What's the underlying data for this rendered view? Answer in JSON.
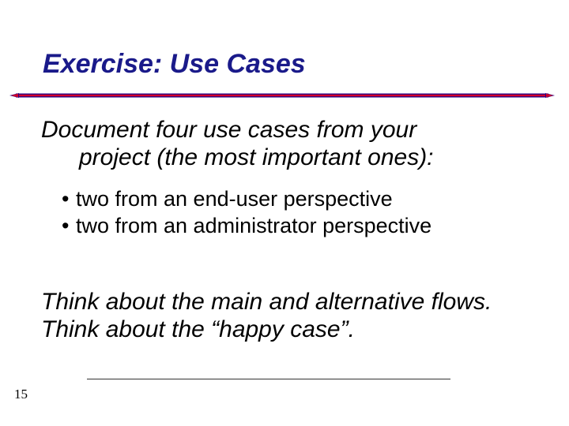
{
  "title": "Exercise: Use Cases",
  "intro": {
    "line1": "Document four use cases from your",
    "line2": "project (the most important ones):"
  },
  "bullets": [
    "two from an end-user perspective",
    "two from an administrator perspective"
  ],
  "closing": "Think about the main and alternative flows. Think about the “happy case”.",
  "page_number": "15",
  "colors": {
    "title": "#1a1a8a",
    "line_outer": "#2a0080",
    "line_inner": "#d4002a"
  }
}
